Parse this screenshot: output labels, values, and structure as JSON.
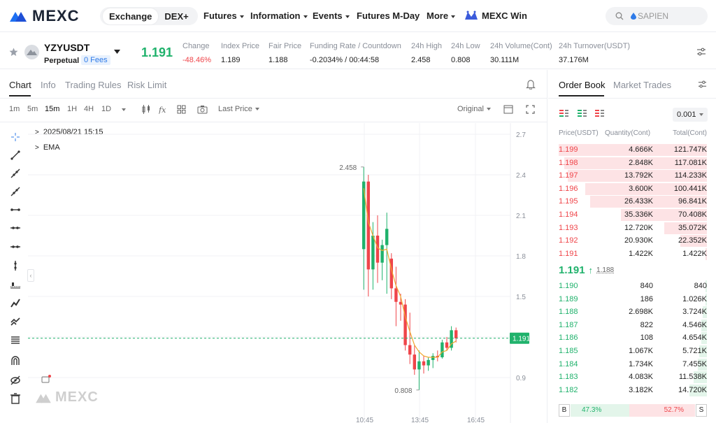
{
  "nav": {
    "logo": "MEXC",
    "seg_exchange": "Exchange",
    "seg_dex": "DEX+",
    "futures": "Futures",
    "information": "Information",
    "events": "Events",
    "mday": "Futures M-Day",
    "more": "More",
    "win": "MEXC Win",
    "search_placeholder": "SAPIEN"
  },
  "ticker": {
    "symbol": "YZYUSDT",
    "perpetual": "Perpetual",
    "fees": "0 Fees",
    "last": "1.191",
    "change_label": "Change",
    "change": "-48.46%",
    "index_label": "Index Price",
    "index": "1.189",
    "fair_label": "Fair Price",
    "fair": "1.188",
    "funding_label": "Funding Rate / Countdown",
    "funding": "-0.2034% / 00:44:58",
    "high_label": "24h High",
    "high": "2.458",
    "low_label": "24h Low",
    "low": "0.808",
    "vol_label": "24h Volume(Cont)",
    "vol": "30.111M",
    "turnover_label": "24h Turnover(USDT)",
    "turnover": "37.176M"
  },
  "chart_tabs": {
    "chart": "Chart",
    "info": "Info",
    "rules": "Trading Rules",
    "risk": "Risk Limit"
  },
  "toolbar": {
    "tf": [
      "1m",
      "5m",
      "15m",
      "1H",
      "4H",
      "1D"
    ],
    "price_type": "Last Price",
    "scale": "Original"
  },
  "legend": {
    "date": "2025/08/21 15:15",
    "ema": "EMA"
  },
  "chart_labels": {
    "high": "2.458",
    "low": "0.808",
    "current": "1.191",
    "y_ticks": [
      "2.7",
      "2.4",
      "2.1",
      "1.8",
      "1.5",
      "1.2",
      "0.9"
    ],
    "x_ticks": [
      "10:45",
      "13:45",
      "16:45"
    ],
    "watermark": "MEXC"
  },
  "orderbook": {
    "tab_book": "Order Book",
    "tab_trades": "Market Trades",
    "precision": "0.001",
    "col_price": "Price(USDT)",
    "col_qty": "Quantity(Cont)",
    "col_total": "Total(Cont)",
    "asks": [
      {
        "price": "1.199",
        "qty": "4.666K",
        "total": "121.747K",
        "depth": 1.0
      },
      {
        "price": "1.198",
        "qty": "2.848K",
        "total": "117.081K",
        "depth": 0.96
      },
      {
        "price": "1.197",
        "qty": "13.792K",
        "total": "114.233K",
        "depth": 0.94
      },
      {
        "price": "1.196",
        "qty": "3.600K",
        "total": "100.441K",
        "depth": 0.82
      },
      {
        "price": "1.195",
        "qty": "26.433K",
        "total": "96.841K",
        "depth": 0.79
      },
      {
        "price": "1.194",
        "qty": "35.336K",
        "total": "70.408K",
        "depth": 0.58
      },
      {
        "price": "1.193",
        "qty": "12.720K",
        "total": "35.072K",
        "depth": 0.29
      },
      {
        "price": "1.192",
        "qty": "20.930K",
        "total": "22.352K",
        "depth": 0.18
      },
      {
        "price": "1.191",
        "qty": "1.422K",
        "total": "1.422K",
        "depth": 0.01
      }
    ],
    "mid_price": "1.191",
    "mid_fair": "1.188",
    "bids": [
      {
        "price": "1.190",
        "qty": "840",
        "total": "840",
        "depth": 0.01
      },
      {
        "price": "1.189",
        "qty": "186",
        "total": "1.026K",
        "depth": 0.01
      },
      {
        "price": "1.188",
        "qty": "2.698K",
        "total": "3.724K",
        "depth": 0.03
      },
      {
        "price": "1.187",
        "qty": "822",
        "total": "4.546K",
        "depth": 0.04
      },
      {
        "price": "1.186",
        "qty": "108",
        "total": "4.654K",
        "depth": 0.04
      },
      {
        "price": "1.185",
        "qty": "1.067K",
        "total": "5.721K",
        "depth": 0.05
      },
      {
        "price": "1.184",
        "qty": "1.734K",
        "total": "7.455K",
        "depth": 0.06
      },
      {
        "price": "1.183",
        "qty": "4.083K",
        "total": "11.538K",
        "depth": 0.09
      },
      {
        "price": "1.182",
        "qty": "3.182K",
        "total": "14.720K",
        "depth": 0.12
      }
    ],
    "buy_label": "B",
    "buy_pct": "47.3%",
    "sell_pct": "52.7%",
    "sell_label": "S",
    "buy_ratio": 0.473
  },
  "colors": {
    "green": "#20b26c",
    "red": "#ef454a",
    "ask_bg": "#fde3e5",
    "bid_bg": "#e3f5ea"
  },
  "candles": [
    {
      "o": 1.85,
      "h": 2.458,
      "l": 1.55,
      "c": 2.35
    },
    {
      "o": 2.35,
      "h": 2.4,
      "l": 1.5,
      "c": 1.7
    },
    {
      "o": 1.7,
      "h": 2.05,
      "l": 1.55,
      "c": 1.95
    },
    {
      "o": 1.95,
      "h": 2.1,
      "l": 1.6,
      "c": 1.75
    },
    {
      "o": 1.75,
      "h": 1.92,
      "l": 1.62,
      "c": 1.88
    },
    {
      "o": 1.88,
      "h": 2.12,
      "l": 1.52,
      "c": 2.0
    },
    {
      "o": 1.78,
      "h": 1.82,
      "l": 1.48,
      "c": 1.56
    },
    {
      "o": 1.56,
      "h": 1.72,
      "l": 1.28,
      "c": 1.46
    },
    {
      "o": 1.46,
      "h": 1.52,
      "l": 1.32,
      "c": 1.44
    },
    {
      "o": 1.44,
      "h": 1.48,
      "l": 1.1,
      "c": 1.14
    },
    {
      "o": 1.14,
      "h": 1.38,
      "l": 1.0,
      "c": 1.07
    },
    {
      "o": 1.07,
      "h": 1.14,
      "l": 0.92,
      "c": 0.96
    },
    {
      "o": 0.96,
      "h": 1.1,
      "l": 0.808,
      "c": 1.02
    },
    {
      "o": 1.02,
      "h": 1.06,
      "l": 0.93,
      "c": 0.99
    },
    {
      "o": 0.99,
      "h": 1.05,
      "l": 0.95,
      "c": 1.03
    },
    {
      "o": 1.03,
      "h": 1.08,
      "l": 0.97,
      "c": 1.06
    },
    {
      "o": 1.06,
      "h": 1.1,
      "l": 1.02,
      "c": 1.05
    },
    {
      "o": 1.05,
      "h": 1.18,
      "l": 1.04,
      "c": 1.16
    },
    {
      "o": 1.16,
      "h": 1.2,
      "l": 1.1,
      "c": 1.12
    },
    {
      "o": 1.12,
      "h": 1.28,
      "l": 1.1,
      "c": 1.25
    },
    {
      "o": 1.25,
      "h": 1.27,
      "l": 1.16,
      "c": 1.19
    }
  ],
  "ema": [
    2.3,
    2.05,
    1.95,
    1.86,
    1.84,
    1.85,
    1.7,
    1.58,
    1.5,
    1.35,
    1.24,
    1.14,
    1.09,
    1.06,
    1.05,
    1.05,
    1.05,
    1.09,
    1.1,
    1.15,
    1.17
  ]
}
